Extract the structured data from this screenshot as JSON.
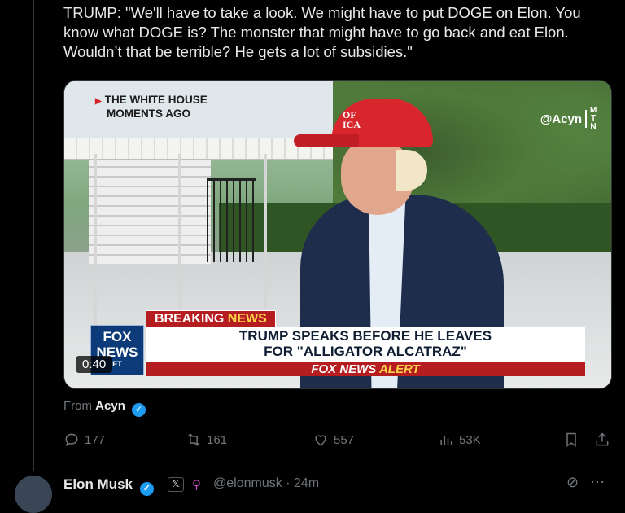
{
  "tweet": {
    "text": "TRUMP: \"We'll have to take a look. We might have to put DOGE on Elon. You know what DOGE is? The monster that might have to go back and eat Elon. Wouldn’t that be terrible? He gets a lot of subsidies.\""
  },
  "video": {
    "location_tag_line1": "THE WHITE HOUSE",
    "location_tag_line2": "MOMENTS AGO",
    "watermark": "@Acyn",
    "watermark_stack": "M T N",
    "cap_text": "OF\nICA",
    "breaking_label": "BREAKING",
    "breaking_news": "NEWS",
    "headline_line1": "TRUMP SPEAKS BEFORE HE LEAVES",
    "headline_line2": "FOR \"ALLIGATOR ALCATRAZ\"",
    "alert_prefix": "FOX NEWS",
    "alert_word": "ALERT",
    "fox_logo": "FOX NEWS",
    "fox_logo_sub": "ET",
    "duration": "0:40"
  },
  "source": {
    "from_label": "From",
    "name": "Acyn"
  },
  "actions": {
    "replies": "177",
    "reposts": "161",
    "likes": "557",
    "views": "53K"
  },
  "reply": {
    "name": "Elon Musk",
    "handle_time": "@elonmusk · 24m"
  },
  "colors": {
    "background": "#000000",
    "text": "#e7e9ea",
    "muted": "#71767b",
    "verified": "#1d9bf0",
    "fox_red": "#b51d21",
    "alert_yellow": "#ffd54a"
  }
}
